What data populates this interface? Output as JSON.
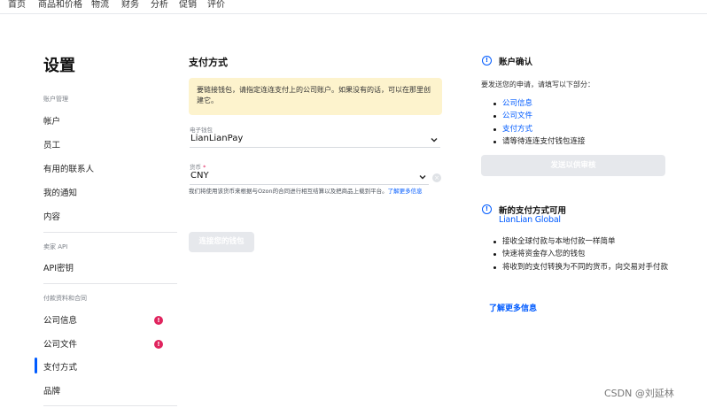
{
  "topnav": [
    "首页",
    "商品和价格",
    "物流",
    "财务",
    "分析",
    "促销",
    "评价"
  ],
  "sidebar": {
    "title": "设置",
    "section1": "账户管理",
    "section1_items": [
      "帐户",
      "员工",
      "有用的联系人",
      "我的通知",
      "内容"
    ],
    "section2": "卖家 API",
    "section2_items": [
      "API密钥"
    ],
    "section3": "付款资料和合同",
    "company_info": "公司信息",
    "company_docs": "公司文件",
    "payment_method": "支付方式",
    "brand": "品牌",
    "badge_symbol": "!",
    "active": "支付方式"
  },
  "main": {
    "title": "支付方式",
    "warning": "要链接钱包，请指定连连支付上的公司账户。如果没有的话，可以在那里创建它。",
    "wallet_label": "电子钱包",
    "wallet_value": "LianLianPay",
    "currency_label": "货币",
    "currency_required": "*",
    "currency_value": "CNY",
    "hint": "我们将使用该货币来根据与Ozon的合同进行相互结算以及把商品上载到平台。",
    "hint_link": "了解更多信息",
    "connect_button": "连接您的钱包"
  },
  "right": {
    "confirm_title": "账户确认",
    "confirm_intro": "要发送您的申请，请填写以下部分：",
    "confirm_items": [
      {
        "text": "公司信息",
        "link": true
      },
      {
        "text": "公司文件",
        "link": true
      },
      {
        "text": "支付方式",
        "link": true
      },
      {
        "text": "请等待连连支付钱包连接",
        "link": false
      }
    ],
    "send_button": "发送以供审核",
    "new_title": "新的支付方式可用",
    "brand_name": "LianLian Global",
    "benefits": [
      "接收全球付款与本地付款一样简单",
      "快速将资金存入您的钱包",
      "将收到的支付转换为不同的货币，向交易对手付款"
    ],
    "more_link": "了解更多信息"
  },
  "watermark": "CSDN @刘延林",
  "colors": {
    "accent": "#005bff",
    "warning_bg": "#fdf3cd",
    "badge": "#e0245e"
  }
}
